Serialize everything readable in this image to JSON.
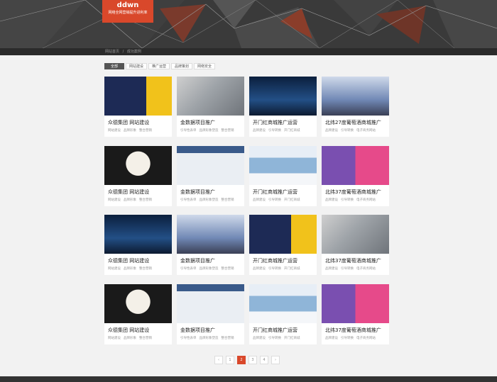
{
  "logo": {
    "title": "ddwn",
    "subtitle": "网络全网营销提升进利率"
  },
  "breadcrumb": [
    "网站首页",
    "成功案例"
  ],
  "filters": [
    "全部",
    "网站建设",
    "推广运营",
    "品牌策划",
    "网络安全"
  ],
  "cards": [
    {
      "title": "众德集团  网站建设",
      "tags": [
        "网站建设",
        "品牌形象",
        "整合营销"
      ],
      "thumb": "speed"
    },
    {
      "title": "金数据项目推广",
      "tags": [
        "引导性表单",
        "品牌形象塑造",
        "整合营销"
      ],
      "thumb": "build"
    },
    {
      "title": "开门红商城推广运营",
      "tags": [
        "品牌建设",
        "引导转换",
        "开门红商城"
      ],
      "thumb": "car"
    },
    {
      "title": "北纬27度葡萄酒商城推广",
      "tags": [
        "品牌建设",
        "引导转换",
        "电子商务网站"
      ],
      "thumb": "city"
    },
    {
      "title": "众德集团  网站建设",
      "tags": [
        "网站建设",
        "品牌形象",
        "整合营销"
      ],
      "thumb": "card"
    },
    {
      "title": "金数据项目推广",
      "tags": [
        "引导性表单",
        "品牌形象塑造",
        "整合营销"
      ],
      "thumb": "web"
    },
    {
      "title": "开门红商城推广运营",
      "tags": [
        "品牌建设",
        "引导转换",
        "开门红商城"
      ],
      "thumb": "snow"
    },
    {
      "title": "北纬37度葡萄酒商城推广",
      "tags": [
        "品牌建设",
        "引导转换",
        "电子商务网站"
      ],
      "thumb": "purple"
    },
    {
      "title": "众德集团  网站建设",
      "tags": [
        "网站建设",
        "品牌形象",
        "整合营销"
      ],
      "thumb": "car"
    },
    {
      "title": "金数据项目推广",
      "tags": [
        "引导性表单",
        "品牌形象塑造",
        "整合营销"
      ],
      "thumb": "city"
    },
    {
      "title": "开门红商城推广运营",
      "tags": [
        "品牌建设",
        "引导转换",
        "开门红商城"
      ],
      "thumb": "speed"
    },
    {
      "title": "北纬37度葡萄酒商城推广",
      "tags": [
        "品牌建设",
        "引导转换",
        "电子商务网站"
      ],
      "thumb": "build"
    },
    {
      "title": "众德集团  网站建设",
      "tags": [
        "网站建设",
        "品牌形象",
        "整合营销"
      ],
      "thumb": "card"
    },
    {
      "title": "金数据项目推广",
      "tags": [
        "引导性表单",
        "品牌形象塑造",
        "整合营销"
      ],
      "thumb": "web"
    },
    {
      "title": "开门红商城推广运营",
      "tags": [
        "品牌建设",
        "引导转换",
        "开门红商城"
      ],
      "thumb": "snow"
    },
    {
      "title": "北纬37度葡萄酒商城推广",
      "tags": [
        "品牌建设",
        "引导转换",
        "电子商务网站"
      ],
      "thumb": "purple"
    }
  ],
  "pagination": {
    "prev": "‹",
    "pages": [
      "1",
      "2",
      "3",
      "4"
    ],
    "current": "2",
    "next": "›"
  },
  "colors": {
    "accent": "#d9482b",
    "dark": "#3a3a3a"
  }
}
